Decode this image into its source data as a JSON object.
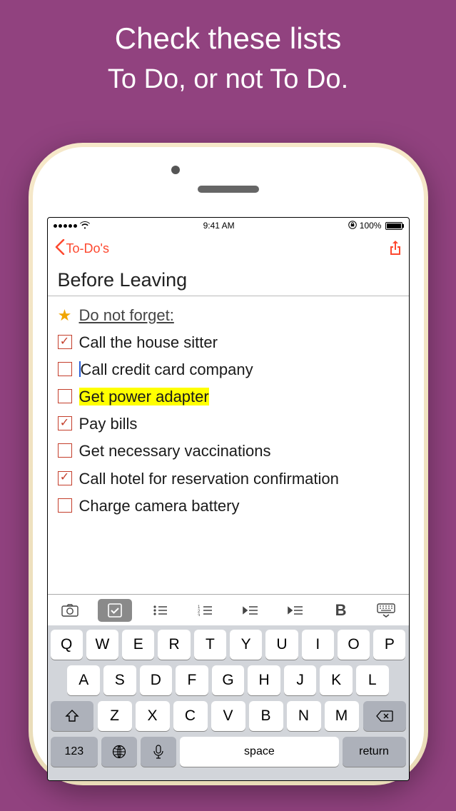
{
  "promo": {
    "line1": "Check these lists",
    "line2": "To Do, or not To Do."
  },
  "status": {
    "time": "9:41 AM",
    "battery": "100%"
  },
  "nav": {
    "back_label": "To-Do's"
  },
  "note": {
    "title": "Before Leaving",
    "heading": "Do not forget:",
    "items": [
      {
        "checked": true,
        "text": "Call the house sitter"
      },
      {
        "checked": false,
        "text": "Call credit card company",
        "cursor_before": true
      },
      {
        "checked": false,
        "text": "Get power adapter",
        "highlight": true
      },
      {
        "checked": true,
        "text": "Pay bills"
      },
      {
        "checked": false,
        "text": "Get necessary vaccinations"
      },
      {
        "checked": true,
        "text": "Call hotel for reservation confirmation"
      },
      {
        "checked": false,
        "text": "Charge camera battery"
      }
    ]
  },
  "keyboard": {
    "row1": [
      "Q",
      "W",
      "E",
      "R",
      "T",
      "Y",
      "U",
      "I",
      "O",
      "P"
    ],
    "row2": [
      "A",
      "S",
      "D",
      "F",
      "G",
      "H",
      "J",
      "K",
      "L"
    ],
    "row3": [
      "Z",
      "X",
      "C",
      "V",
      "B",
      "N",
      "M"
    ],
    "numbers_label": "123",
    "space_label": "space",
    "return_label": "return"
  },
  "colors": {
    "accent": "#fd482f",
    "check": "#c43e2b",
    "highlight": "#ffff00",
    "bg": "#91427f"
  }
}
